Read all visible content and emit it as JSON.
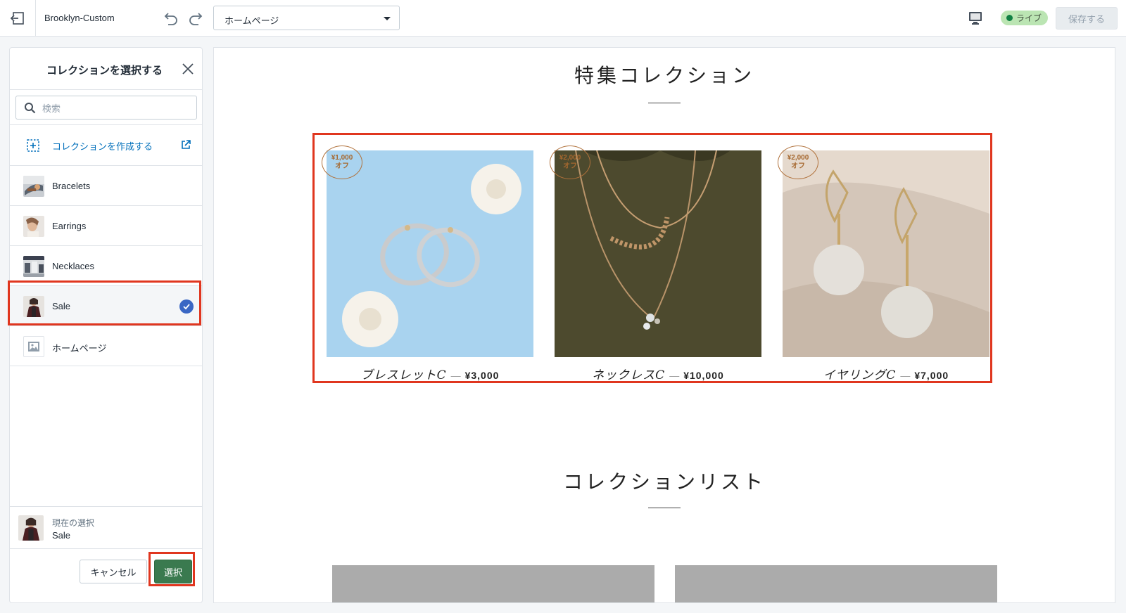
{
  "topbar": {
    "theme_name": "Brooklyn-Custom",
    "page_select_value": "ホームページ",
    "live_label": "ライブ",
    "save_label": "保存する"
  },
  "sidebar": {
    "title": "コレクションを選択する",
    "search_placeholder": "検索",
    "create_label": "コレクションを作成する",
    "items": [
      {
        "label": "Bracelets",
        "selected": false
      },
      {
        "label": "Earrings",
        "selected": false
      },
      {
        "label": "Necklaces",
        "selected": false
      },
      {
        "label": "Sale",
        "selected": true
      },
      {
        "label": "ホームページ",
        "selected": false
      }
    ],
    "current_label": "現在の選択",
    "current_value": "Sale",
    "cancel_label": "キャンセル",
    "select_label": "選択"
  },
  "preview": {
    "featured_title": "特集コレクション",
    "list_title": "コレクションリスト",
    "products": [
      {
        "name": "ブレスレットC",
        "dash": "—",
        "price": "¥3,000",
        "badge_amount": "¥1,000",
        "badge_suffix": "オフ"
      },
      {
        "name": "ネックレスC",
        "dash": "—",
        "price": "¥10,000",
        "badge_amount": "¥2,000",
        "badge_suffix": "オフ"
      },
      {
        "name": "イヤリングC",
        "dash": "—",
        "price": "¥7,000",
        "badge_amount": "¥2,000",
        "badge_suffix": "オフ"
      }
    ]
  },
  "colors": {
    "accent_green": "#3a7a4f",
    "link_blue": "#006fbb",
    "check_blue": "#3a67c4",
    "highlight_red": "#e0361f",
    "live_badge_bg": "#bbe5b3"
  }
}
